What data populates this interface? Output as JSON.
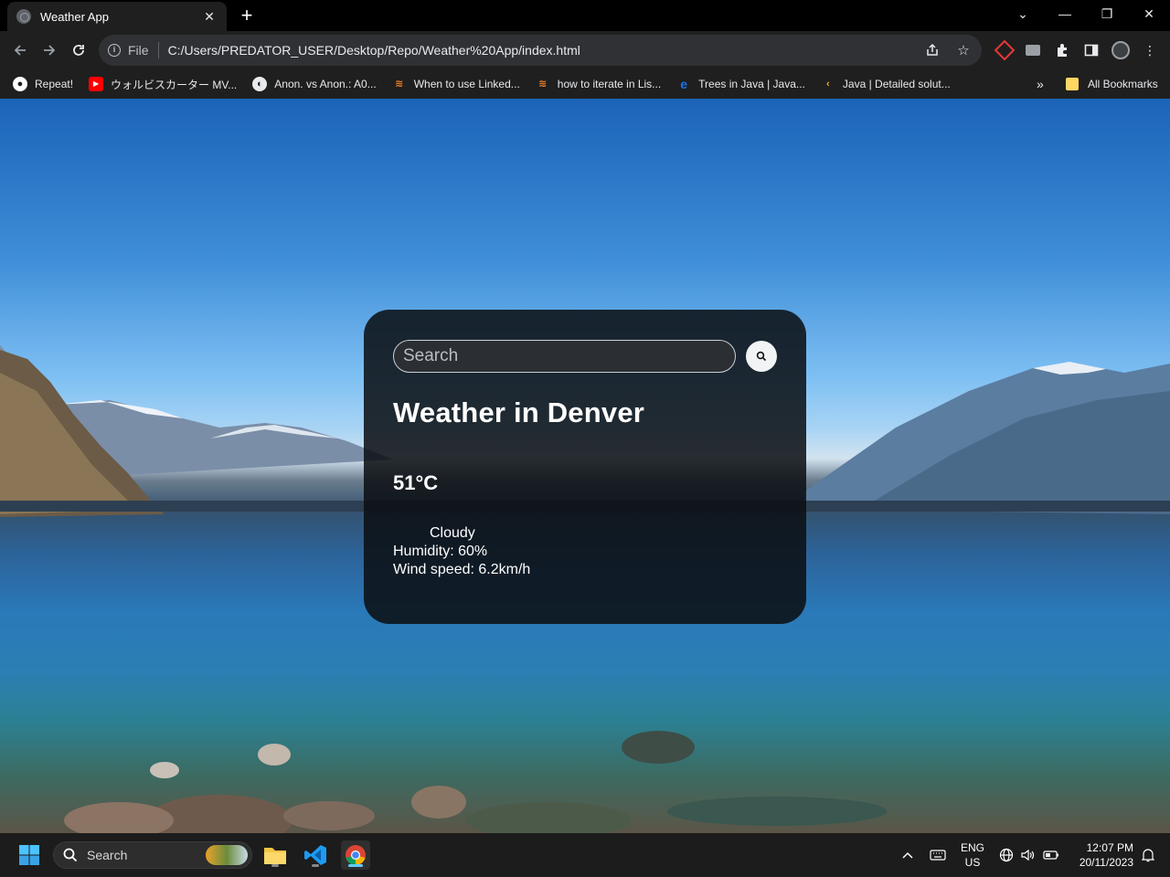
{
  "browser": {
    "tab": {
      "title": "Weather App",
      "close": "✕"
    },
    "new_tab": "+",
    "window_controls": {
      "tab_search": "⌄",
      "minimize": "—",
      "restore": "❐",
      "close": "✕"
    },
    "omnibox": {
      "scheme": "File",
      "url": "C:/Users/PREDATOR_USER/Desktop/Repo/Weather%20App/index.html"
    },
    "bookmarks": [
      {
        "label": "Repeat!",
        "icon": "globe-icon"
      },
      {
        "label": "ウォルビスカーター MV...",
        "icon": "youtube-icon"
      },
      {
        "label": "Anon. vs Anon.: A0...",
        "icon": "site-icon"
      },
      {
        "label": "When to use Linked...",
        "icon": "stackoverflow-icon"
      },
      {
        "label": "how to iterate in Lis...",
        "icon": "stackoverflow-icon"
      },
      {
        "label": "Trees in Java | Java...",
        "icon": "educative-icon"
      },
      {
        "label": "Java | Detailed solut...",
        "icon": "leetcode-icon"
      }
    ],
    "bookmarks_overflow": "»",
    "all_bookmarks": "All Bookmarks"
  },
  "weather": {
    "search_placeholder": "Search",
    "city": "Weather in Denver",
    "temperature": "51°C",
    "description": "Cloudy",
    "humidity": "Humidity: 60%",
    "wind": "Wind speed: 6.2km/h"
  },
  "taskbar": {
    "search_label": "Search",
    "language": "ENG",
    "region": "US",
    "time": "12:07 PM",
    "date": "20/11/2023"
  },
  "colors": {
    "card_bg": "#0a0e12",
    "chrome_bg": "#1f1f1f",
    "omnibox_bg": "#303134",
    "taskbar_bg": "#1c1c1c"
  }
}
